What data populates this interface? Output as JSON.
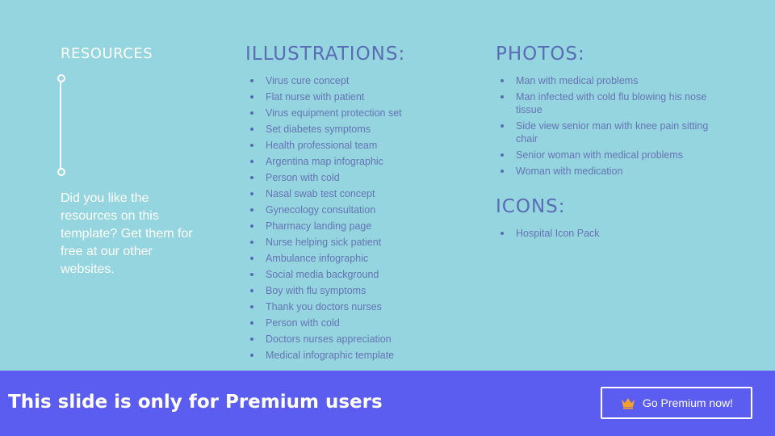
{
  "resources": {
    "title": "RESOURCES",
    "body": "Did you like the resources on this template? Get them for free at our other websites."
  },
  "illustrations": {
    "heading": "ILLUSTRATIONS:",
    "items": [
      "Virus cure concept",
      "Flat nurse with patient",
      "Virus equipment protection set",
      "Set diabetes symptoms",
      "Health professional team",
      "Argentina map infographic",
      "Person with cold",
      "Nasal swab test concept",
      "Gynecology consultation",
      "Pharmacy landing page",
      "Nurse helping sick patient",
      "Ambulance infographic",
      "Social media background",
      "Boy with flu symptoms",
      "Thank you doctors nurses",
      "Person with cold",
      "Doctors nurses appreciation",
      "Medical infographic template"
    ]
  },
  "photos": {
    "heading": "PHOTOS:",
    "items": [
      "Man with medical problems",
      "Man infected with cold flu blowing his nose tissue",
      "Side view senior man with knee pain sitting chair",
      "Senior woman with medical problems",
      "Woman with medication"
    ]
  },
  "icons": {
    "heading": "ICONS:",
    "items": [
      "Hospital Icon Pack"
    ]
  },
  "banner": {
    "text": "This slide is only for Premium users",
    "button_label": "Go Premium now!",
    "button_icon": "crown-icon"
  },
  "colors": {
    "background": "#95d5df",
    "heading": "#5a6cb5",
    "banner": "#5b5cf0",
    "crown": "#f0a030"
  }
}
